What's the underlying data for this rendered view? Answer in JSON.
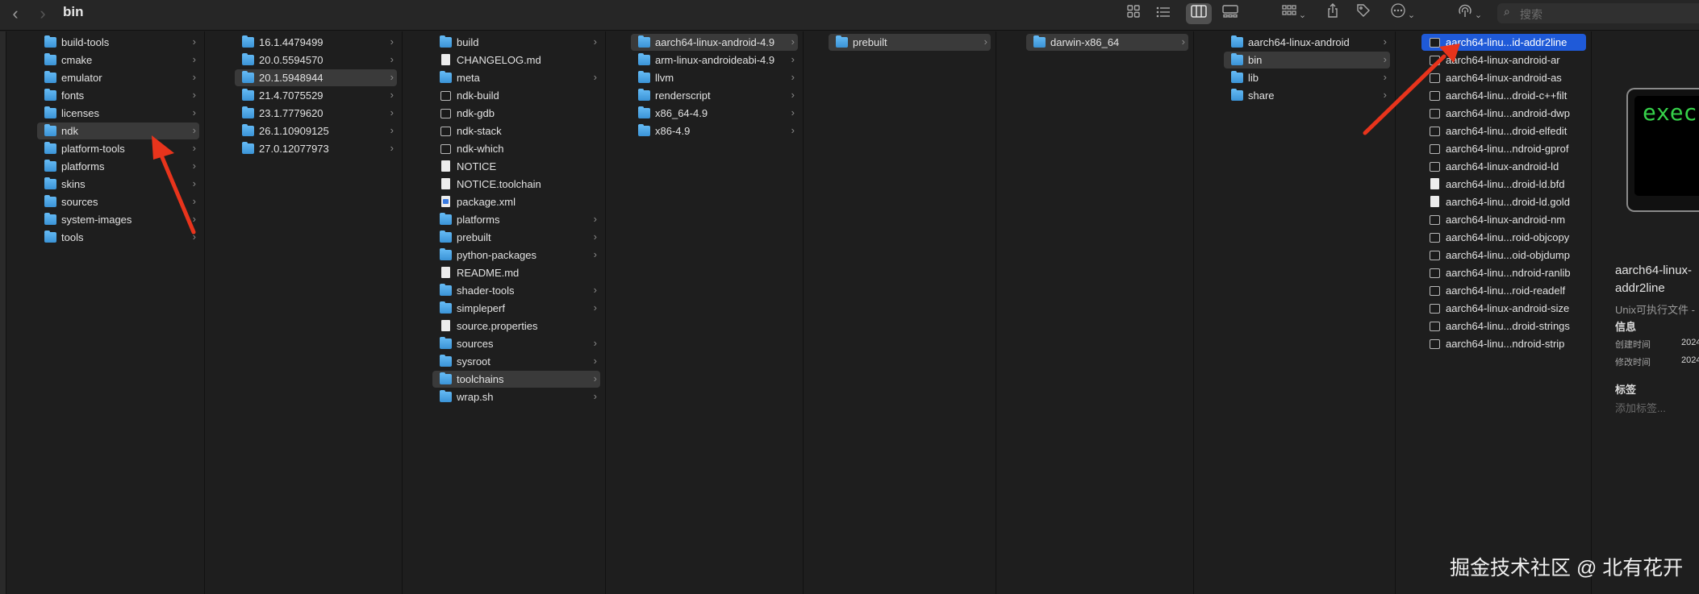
{
  "window": {
    "title": "bin"
  },
  "toolbar": {
    "back_glyph": "‹",
    "forward_glyph": "›",
    "icons": [
      "grid-view-icon",
      "list-view-icon",
      "column-view-icon",
      "gallery-view-icon",
      "group-icon",
      "share-icon",
      "tag-icon",
      "more-icon",
      "airdrop-icon",
      "search-icon"
    ],
    "search_placeholder": "搜索"
  },
  "columns": [
    {
      "items": [
        {
          "name": "build-tools",
          "type": "folder",
          "chevron": true
        },
        {
          "name": "cmake",
          "type": "folder",
          "chevron": true
        },
        {
          "name": "emulator",
          "type": "folder",
          "chevron": true
        },
        {
          "name": "fonts",
          "type": "folder",
          "chevron": true
        },
        {
          "name": "licenses",
          "type": "folder",
          "chevron": true
        },
        {
          "name": "ndk",
          "type": "folder",
          "chevron": true,
          "selected": true
        },
        {
          "name": "platform-tools",
          "type": "folder",
          "chevron": true
        },
        {
          "name": "platforms",
          "type": "folder",
          "chevron": true
        },
        {
          "name": "skins",
          "type": "folder",
          "chevron": true
        },
        {
          "name": "sources",
          "type": "folder",
          "chevron": true
        },
        {
          "name": "system-images",
          "type": "folder",
          "chevron": true
        },
        {
          "name": "tools",
          "type": "folder",
          "chevron": true
        }
      ]
    },
    {
      "items": [
        {
          "name": "16.1.4479499",
          "type": "folder",
          "chevron": true
        },
        {
          "name": "20.0.5594570",
          "type": "folder",
          "chevron": true
        },
        {
          "name": "20.1.5948944",
          "type": "folder",
          "chevron": true,
          "selected": true
        },
        {
          "name": "21.4.7075529",
          "type": "folder",
          "chevron": true
        },
        {
          "name": "23.1.7779620",
          "type": "folder",
          "chevron": true
        },
        {
          "name": "26.1.10909125",
          "type": "folder",
          "chevron": true
        },
        {
          "name": "27.0.12077973",
          "type": "folder",
          "chevron": true
        }
      ]
    },
    {
      "items": [
        {
          "name": "build",
          "type": "folder",
          "chevron": true
        },
        {
          "name": "CHANGELOG.md",
          "type": "doc",
          "chevron": false
        },
        {
          "name": "meta",
          "type": "folder",
          "chevron": true
        },
        {
          "name": "ndk-build",
          "type": "exec",
          "chevron": false
        },
        {
          "name": "ndk-gdb",
          "type": "exec",
          "chevron": false
        },
        {
          "name": "ndk-stack",
          "type": "exec",
          "chevron": false
        },
        {
          "name": "ndk-which",
          "type": "exec",
          "chevron": false
        },
        {
          "name": "NOTICE",
          "type": "doc",
          "chevron": false
        },
        {
          "name": "NOTICE.toolchain",
          "type": "doc",
          "chevron": false
        },
        {
          "name": "package.xml",
          "type": "xml",
          "chevron": false
        },
        {
          "name": "platforms",
          "type": "folder",
          "chevron": true
        },
        {
          "name": "prebuilt",
          "type": "folder",
          "chevron": true
        },
        {
          "name": "python-packages",
          "type": "folder",
          "chevron": true
        },
        {
          "name": "README.md",
          "type": "doc",
          "chevron": false
        },
        {
          "name": "shader-tools",
          "type": "folder",
          "chevron": true
        },
        {
          "name": "simpleperf",
          "type": "folder",
          "chevron": true
        },
        {
          "name": "source.properties",
          "type": "doc",
          "chevron": false
        },
        {
          "name": "sources",
          "type": "folder",
          "chevron": true
        },
        {
          "name": "sysroot",
          "type": "folder",
          "chevron": true
        },
        {
          "name": "toolchains",
          "type": "folder",
          "chevron": true,
          "selected": true
        },
        {
          "name": "wrap.sh",
          "type": "folder",
          "chevron": true
        }
      ]
    },
    {
      "items": [
        {
          "name": "aarch64-linux-android-4.9",
          "type": "folder",
          "chevron": true,
          "selected": true
        },
        {
          "name": "arm-linux-androideabi-4.9",
          "type": "folder",
          "chevron": true
        },
        {
          "name": "llvm",
          "type": "folder",
          "chevron": true
        },
        {
          "name": "renderscript",
          "type": "folder",
          "chevron": true
        },
        {
          "name": "x86_64-4.9",
          "type": "folder",
          "chevron": true
        },
        {
          "name": "x86-4.9",
          "type": "folder",
          "chevron": true
        }
      ]
    },
    {
      "items": [
        {
          "name": "prebuilt",
          "type": "folder",
          "chevron": true,
          "selected": true
        }
      ]
    },
    {
      "items": [
        {
          "name": "darwin-x86_64",
          "type": "folder",
          "chevron": true,
          "selected": true
        }
      ]
    },
    {
      "items": [
        {
          "name": "aarch64-linux-android",
          "type": "folder",
          "chevron": true
        },
        {
          "name": "bin",
          "type": "folder",
          "chevron": true,
          "selected": true
        },
        {
          "name": "lib",
          "type": "folder",
          "chevron": true
        },
        {
          "name": "share",
          "type": "folder",
          "chevron": true
        }
      ]
    },
    {
      "items": [
        {
          "name": "aarch64-linu...id-addr2line",
          "type": "exec",
          "chevron": false,
          "selected_blue": true
        },
        {
          "name": "aarch64-linux-android-ar",
          "type": "exec",
          "chevron": false
        },
        {
          "name": "aarch64-linux-android-as",
          "type": "exec",
          "chevron": false
        },
        {
          "name": "aarch64-linu...droid-c++filt",
          "type": "exec",
          "chevron": false
        },
        {
          "name": "aarch64-linu...android-dwp",
          "type": "exec",
          "chevron": false
        },
        {
          "name": "aarch64-linu...droid-elfedit",
          "type": "exec",
          "chevron": false
        },
        {
          "name": "aarch64-linu...ndroid-gprof",
          "type": "exec",
          "chevron": false
        },
        {
          "name": "aarch64-linux-android-ld",
          "type": "exec",
          "chevron": false
        },
        {
          "name": "aarch64-linu...droid-ld.bfd",
          "type": "doc",
          "chevron": false
        },
        {
          "name": "aarch64-linu...droid-ld.gold",
          "type": "doc",
          "chevron": false
        },
        {
          "name": "aarch64-linux-android-nm",
          "type": "exec",
          "chevron": false
        },
        {
          "name": "aarch64-linu...roid-objcopy",
          "type": "exec",
          "chevron": false
        },
        {
          "name": "aarch64-linu...oid-objdump",
          "type": "exec",
          "chevron": false
        },
        {
          "name": "aarch64-linu...ndroid-ranlib",
          "type": "exec",
          "chevron": false
        },
        {
          "name": "aarch64-linu...roid-readelf",
          "type": "exec",
          "chevron": false
        },
        {
          "name": "aarch64-linux-android-size",
          "type": "exec",
          "chevron": false
        },
        {
          "name": "aarch64-linu...droid-strings",
          "type": "exec",
          "chevron": false
        },
        {
          "name": "aarch64-linu...ndroid-strip",
          "type": "exec",
          "chevron": false
        }
      ]
    }
  ],
  "preview": {
    "thumb_text": "exec",
    "name_line1": "aarch64-linux-",
    "name_line2": "addr2line",
    "kind": "Unix可执行文件 -",
    "info_heading": "信息",
    "created_label": "创建时间",
    "created_value": "2024",
    "modified_label": "修改时间",
    "modified_value": "2024",
    "tags_heading": "标签",
    "tags_placeholder": "添加标签..."
  },
  "colors": {
    "background": "#1e1e1e",
    "selection_gray": "#3a3a3a",
    "selection_blue": "#1f5ad8",
    "folder_blue": "#3a93d6",
    "arrow_red": "#e8341c"
  },
  "watermark": "掘金技术社区 @ 北有花开"
}
